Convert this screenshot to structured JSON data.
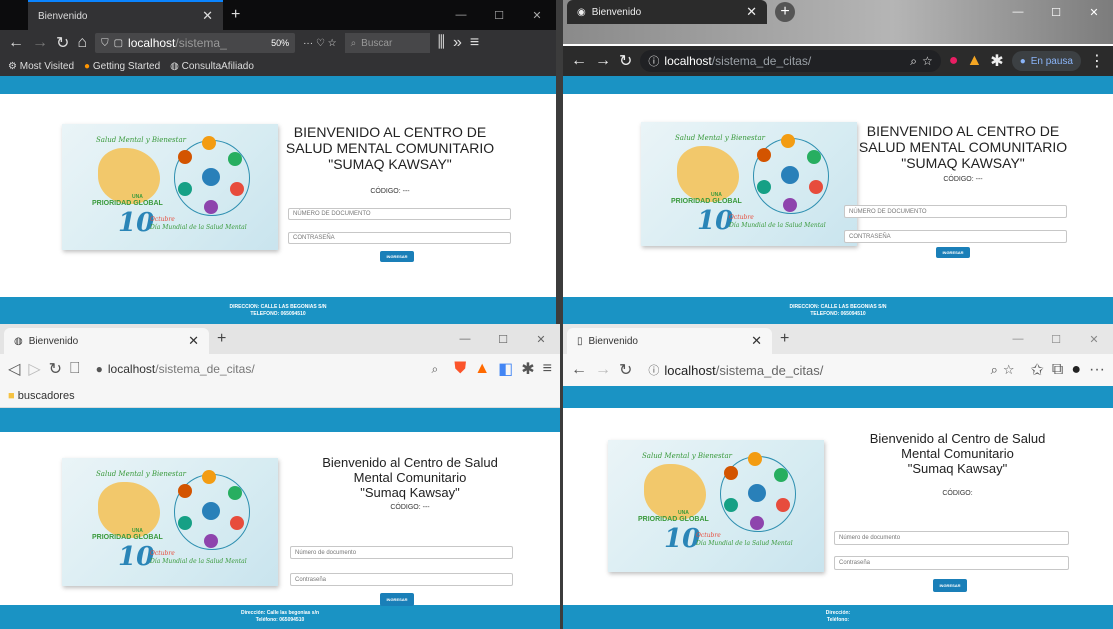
{
  "windows": [
    {
      "id": "firefox",
      "tab_title": "Bienvenido",
      "url_host": "localhost",
      "url_path": "/sistema_",
      "zoom": "50%",
      "search_placeholder": "Buscar",
      "bookmarks": [
        "Most Visited",
        "Getting Started",
        "ConsultaAfiliado"
      ],
      "heading_lines": [
        "BIENVENIDO AL CENTRO DE",
        "SALUD MENTAL COMUNITARIO",
        "\"SUMAQ KAWSAY\""
      ],
      "codigo": "CÓDIGO: ---",
      "doc_placeholder": "NÚMERO DE DOCUMENTO",
      "pass_placeholder": "CONTRASEÑA",
      "button": "INGRESAR",
      "footer_lines": [
        "DIRECCION: CALLE LAS BEGONIAS S/N",
        "TELEFONO: 065094510"
      ]
    },
    {
      "id": "chrome",
      "tab_title": "Bienvenido",
      "url_host": "localhost",
      "url_path": "/sistema_de_citas/",
      "profile_label": "En pausa",
      "heading_lines": [
        "BIENVENIDO AL CENTRO DE",
        "SALUD MENTAL COMUNITARIO",
        "\"SUMAQ KAWSAY\""
      ],
      "codigo": "CÓDIGO: ---",
      "doc_placeholder": "NÚMERO DE DOCUMENTO",
      "pass_placeholder": "CONTRASEÑA",
      "button": "INGRESAR",
      "footer_lines": [
        "DIRECCION: CALLE LAS BEGONIAS S/N",
        "TELEFONO: 065094510"
      ]
    },
    {
      "id": "brave",
      "tab_title": "Bienvenido",
      "url_host": "localhost",
      "url_path": "/sistema_de_citas/",
      "bookmarks": [
        "buscadores"
      ],
      "heading_lines": [
        "Bienvenido al Centro de Salud",
        "Mental Comunitario",
        "\"Sumaq Kawsay\""
      ],
      "codigo": "CÓDIGO: ---",
      "doc_placeholder": "Número de documento",
      "pass_placeholder": "Contraseña",
      "button": "INGRESAR",
      "footer_lines": [
        "Dirección: Calle las begonias s/n",
        "Teléfono: 065094510"
      ]
    },
    {
      "id": "edge",
      "tab_title": "Bienvenido",
      "url_host": "localhost",
      "url_path": "/sistema_de_citas/",
      "heading_lines": [
        "Bienvenido al Centro de Salud",
        "Mental Comunitario",
        "\"Sumaq Kawsay\""
      ],
      "codigo": "CÓDIGO:",
      "doc_placeholder": "Número de documento",
      "pass_placeholder": "Contraseña",
      "button": "INGRESAR",
      "footer_lines": [
        "Dirección:",
        "Teléfono:"
      ]
    }
  ],
  "poster": {
    "title": "Salud Mental y Bienestar",
    "subtitle_una": "UNA",
    "subtitle_main": "PRIORIDAD GLOBAL",
    "day": "10",
    "month": "Octubre",
    "event": "Día Mundial de la Salud Mental"
  },
  "colors": {
    "brand_blue": "#1a93c4",
    "button_blue": "#1a7fb8",
    "firefox_chrome": "#202124",
    "chrome_dark": "#2b2b2b",
    "light_chrome": "#f1f3f4"
  }
}
